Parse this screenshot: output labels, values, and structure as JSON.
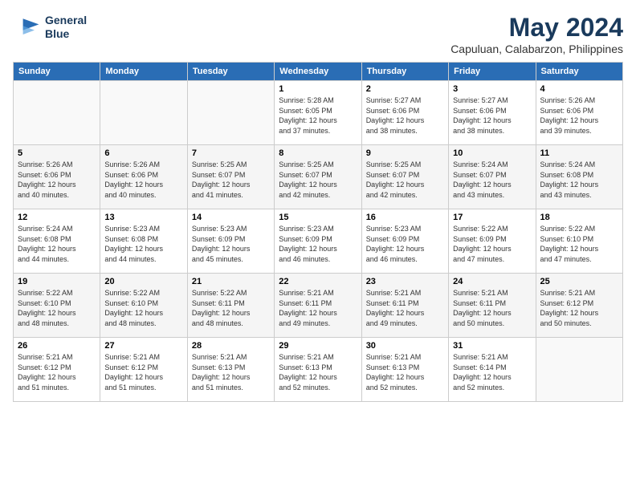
{
  "header": {
    "logo_line1": "General",
    "logo_line2": "Blue",
    "month": "May 2024",
    "location": "Capuluan, Calabarzon, Philippines"
  },
  "weekdays": [
    "Sunday",
    "Monday",
    "Tuesday",
    "Wednesday",
    "Thursday",
    "Friday",
    "Saturday"
  ],
  "weeks": [
    [
      {
        "day": "",
        "info": ""
      },
      {
        "day": "",
        "info": ""
      },
      {
        "day": "",
        "info": ""
      },
      {
        "day": "1",
        "info": "Sunrise: 5:28 AM\nSunset: 6:05 PM\nDaylight: 12 hours\nand 37 minutes."
      },
      {
        "day": "2",
        "info": "Sunrise: 5:27 AM\nSunset: 6:06 PM\nDaylight: 12 hours\nand 38 minutes."
      },
      {
        "day": "3",
        "info": "Sunrise: 5:27 AM\nSunset: 6:06 PM\nDaylight: 12 hours\nand 38 minutes."
      },
      {
        "day": "4",
        "info": "Sunrise: 5:26 AM\nSunset: 6:06 PM\nDaylight: 12 hours\nand 39 minutes."
      }
    ],
    [
      {
        "day": "5",
        "info": "Sunrise: 5:26 AM\nSunset: 6:06 PM\nDaylight: 12 hours\nand 40 minutes."
      },
      {
        "day": "6",
        "info": "Sunrise: 5:26 AM\nSunset: 6:06 PM\nDaylight: 12 hours\nand 40 minutes."
      },
      {
        "day": "7",
        "info": "Sunrise: 5:25 AM\nSunset: 6:07 PM\nDaylight: 12 hours\nand 41 minutes."
      },
      {
        "day": "8",
        "info": "Sunrise: 5:25 AM\nSunset: 6:07 PM\nDaylight: 12 hours\nand 42 minutes."
      },
      {
        "day": "9",
        "info": "Sunrise: 5:25 AM\nSunset: 6:07 PM\nDaylight: 12 hours\nand 42 minutes."
      },
      {
        "day": "10",
        "info": "Sunrise: 5:24 AM\nSunset: 6:07 PM\nDaylight: 12 hours\nand 43 minutes."
      },
      {
        "day": "11",
        "info": "Sunrise: 5:24 AM\nSunset: 6:08 PM\nDaylight: 12 hours\nand 43 minutes."
      }
    ],
    [
      {
        "day": "12",
        "info": "Sunrise: 5:24 AM\nSunset: 6:08 PM\nDaylight: 12 hours\nand 44 minutes."
      },
      {
        "day": "13",
        "info": "Sunrise: 5:23 AM\nSunset: 6:08 PM\nDaylight: 12 hours\nand 44 minutes."
      },
      {
        "day": "14",
        "info": "Sunrise: 5:23 AM\nSunset: 6:09 PM\nDaylight: 12 hours\nand 45 minutes."
      },
      {
        "day": "15",
        "info": "Sunrise: 5:23 AM\nSunset: 6:09 PM\nDaylight: 12 hours\nand 46 minutes."
      },
      {
        "day": "16",
        "info": "Sunrise: 5:23 AM\nSunset: 6:09 PM\nDaylight: 12 hours\nand 46 minutes."
      },
      {
        "day": "17",
        "info": "Sunrise: 5:22 AM\nSunset: 6:09 PM\nDaylight: 12 hours\nand 47 minutes."
      },
      {
        "day": "18",
        "info": "Sunrise: 5:22 AM\nSunset: 6:10 PM\nDaylight: 12 hours\nand 47 minutes."
      }
    ],
    [
      {
        "day": "19",
        "info": "Sunrise: 5:22 AM\nSunset: 6:10 PM\nDaylight: 12 hours\nand 48 minutes."
      },
      {
        "day": "20",
        "info": "Sunrise: 5:22 AM\nSunset: 6:10 PM\nDaylight: 12 hours\nand 48 minutes."
      },
      {
        "day": "21",
        "info": "Sunrise: 5:22 AM\nSunset: 6:11 PM\nDaylight: 12 hours\nand 48 minutes."
      },
      {
        "day": "22",
        "info": "Sunrise: 5:21 AM\nSunset: 6:11 PM\nDaylight: 12 hours\nand 49 minutes."
      },
      {
        "day": "23",
        "info": "Sunrise: 5:21 AM\nSunset: 6:11 PM\nDaylight: 12 hours\nand 49 minutes."
      },
      {
        "day": "24",
        "info": "Sunrise: 5:21 AM\nSunset: 6:11 PM\nDaylight: 12 hours\nand 50 minutes."
      },
      {
        "day": "25",
        "info": "Sunrise: 5:21 AM\nSunset: 6:12 PM\nDaylight: 12 hours\nand 50 minutes."
      }
    ],
    [
      {
        "day": "26",
        "info": "Sunrise: 5:21 AM\nSunset: 6:12 PM\nDaylight: 12 hours\nand 51 minutes."
      },
      {
        "day": "27",
        "info": "Sunrise: 5:21 AM\nSunset: 6:12 PM\nDaylight: 12 hours\nand 51 minutes."
      },
      {
        "day": "28",
        "info": "Sunrise: 5:21 AM\nSunset: 6:13 PM\nDaylight: 12 hours\nand 51 minutes."
      },
      {
        "day": "29",
        "info": "Sunrise: 5:21 AM\nSunset: 6:13 PM\nDaylight: 12 hours\nand 52 minutes."
      },
      {
        "day": "30",
        "info": "Sunrise: 5:21 AM\nSunset: 6:13 PM\nDaylight: 12 hours\nand 52 minutes."
      },
      {
        "day": "31",
        "info": "Sunrise: 5:21 AM\nSunset: 6:14 PM\nDaylight: 12 hours\nand 52 minutes."
      },
      {
        "day": "",
        "info": ""
      }
    ]
  ]
}
